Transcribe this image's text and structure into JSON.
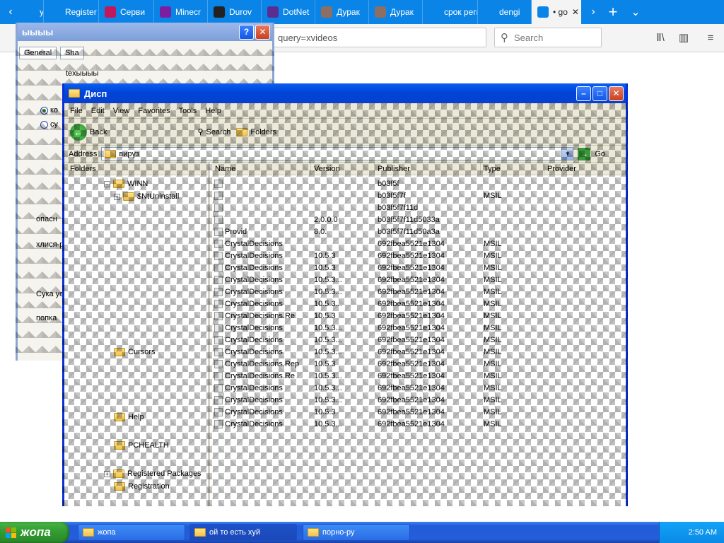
{
  "browser": {
    "tabs": [
      {
        "label": "урак",
        "color": "#0a84e6"
      },
      {
        "label": "Register a",
        "color": "#0a84e6"
      },
      {
        "label": "Серви",
        "color": "#c2185b"
      },
      {
        "label": "Minecr",
        "color": "#7b1fa2"
      },
      {
        "label": "Durov",
        "color": "#222222"
      },
      {
        "label": "DotNet",
        "color": "#5c2d91"
      },
      {
        "label": "Дурак",
        "color": "#8d6e63"
      },
      {
        "label": "Дурак",
        "color": "#8d6e63"
      },
      {
        "label": "срок регис",
        "color": "#0a84e6"
      },
      {
        "label": "dengi",
        "color": "#0a84e6"
      },
      {
        "label": "• go",
        "color": "#0a84e6"
      }
    ],
    "url_text": "query=xvideos",
    "search_placeholder": "Search",
    "accent": "#0a84e6"
  },
  "dialog": {
    "title": "ыыыы",
    "tab_general": "General",
    "tab_share": "Sha",
    "text_field": "texыыыы",
    "radio_1": "ко",
    "radio_2": "су",
    "label_1": "опасн",
    "label_2": "хлися-р",
    "label_3": "Сука уе",
    "label_4": "попка"
  },
  "explorer": {
    "title": "Дисп",
    "menu": [
      "File",
      "Edit",
      "View",
      "Favorites",
      "Tools",
      "Help"
    ],
    "toolbar": {
      "back": "Back",
      "search": "Search",
      "folders": "Folders"
    },
    "address_label": "Address",
    "address_value": "вирүз",
    "go_label": "Go",
    "folders_header": "Folders",
    "tree": [
      {
        "label": "WINN",
        "expander": "-"
      },
      {
        "label": "$NtUninstall",
        "expander": "+"
      },
      {
        "label": "Cursors",
        "expander": ""
      },
      {
        "label": "Help",
        "expander": ""
      },
      {
        "label": "PCHEALTH",
        "expander": ""
      },
      {
        "label": "Registered Packages",
        "expander": "+"
      },
      {
        "label": "Registration",
        "expander": ""
      }
    ],
    "columns": [
      "Name",
      "Version",
      "Publisher",
      "Type",
      "Provider"
    ],
    "rows": [
      {
        "name": "",
        "version": "",
        "pub": "b03f5f",
        "type": "",
        "prov": ""
      },
      {
        "name": "",
        "version": "",
        "pub": "b03f5f7f",
        "type": "MSIL",
        "prov": ""
      },
      {
        "name": "",
        "version": "",
        "pub": "b03f5f7f11d",
        "type": "",
        "prov": ""
      },
      {
        "name": "",
        "version": "2.0.0.0",
        "pub": "b03f5f7f11d5033a",
        "type": "",
        "prov": ""
      },
      {
        "name": "Provid",
        "version": "8.0.",
        "pub": "b03f5f7f11d50a3a",
        "type": "",
        "prov": ""
      },
      {
        "name": "CrystalDecisions",
        "version": "",
        "pub": "692fbea5521e1304",
        "type": "MSIL",
        "prov": ""
      },
      {
        "name": "CrystalDecisions",
        "version": "10.5.3",
        "pub": "692fbea5521e1304",
        "type": "MSIL",
        "prov": ""
      },
      {
        "name": "CrystalDecisions",
        "version": "10.5.3",
        "pub": "692fbea5521e1304",
        "type": "MSIL",
        "prov": ""
      },
      {
        "name": "CrystalDecisions",
        "version": "10.5.3...",
        "pub": "692fbea5521e1304",
        "type": "MSIL",
        "prov": ""
      },
      {
        "name": "CrystalDecisions",
        "version": "10.5.3...",
        "pub": "692fbea5521e1304",
        "type": "MSIL",
        "prov": ""
      },
      {
        "name": "CrystalDecisions",
        "version": "10.5.3...",
        "pub": "692fbea5521e1304",
        "type": "MSIL",
        "prov": ""
      },
      {
        "name": "CrystalDecisions.Re",
        "version": "10.5.3",
        "pub": "692fbea5521e1304",
        "type": "MSIL",
        "prov": ""
      },
      {
        "name": "CrystalDecisions",
        "version": "10.5.3...",
        "pub": "692fbea5521e1304",
        "type": "MSIL",
        "prov": ""
      },
      {
        "name": "CrystalDecisions",
        "version": "10.5.3...",
        "pub": "692fbea5521e1304",
        "type": "MSIL",
        "prov": ""
      },
      {
        "name": "CrystalDecisions",
        "version": "10.5.3...",
        "pub": "692fbea5521e1304",
        "type": "MSIL",
        "prov": ""
      },
      {
        "name": "CrystalDecisions.Rep",
        "version": "10.5.3",
        "pub": "692fbea5521e1304",
        "type": "MSIL",
        "prov": ""
      },
      {
        "name": "CrystalDecisions.Re",
        "version": "10.5.3...",
        "pub": "692fbea5521e1304",
        "type": "MSIL",
        "prov": ""
      },
      {
        "name": "CrystalDecisions",
        "version": "10.5.3...",
        "pub": "692fbea5521e1304",
        "type": "MSIL",
        "prov": ""
      },
      {
        "name": "CrystalDecisions",
        "version": "10.5.3...",
        "pub": "692fbea5521e1304",
        "type": "MSIL",
        "prov": ""
      },
      {
        "name": "CrystalDecisions",
        "version": "10.5.3",
        "pub": "692fbea5521e1304",
        "type": "MSIL",
        "prov": ""
      },
      {
        "name": "CrystalDecisions",
        "version": "10.5.3...",
        "pub": "692fbea5521e1304",
        "type": "MSIL",
        "prov": ""
      }
    ]
  },
  "taskbar": {
    "start_label": "жопа",
    "buttons": [
      {
        "label": "жопа"
      },
      {
        "label": "ой то есть хуй"
      },
      {
        "label": "порно-ру"
      }
    ],
    "clock": "2:50 AM"
  }
}
